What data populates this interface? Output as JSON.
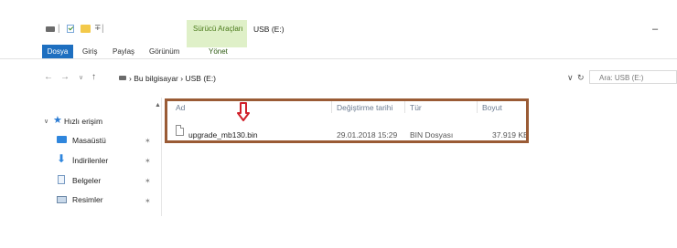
{
  "titlebar": {
    "context_tab_label": "Sürücü Araçları",
    "window_title": "USB (E:)",
    "minimize_glyph": "–",
    "qa_separator": "|",
    "qa_dropdown": "∓"
  },
  "ribbon": {
    "tabs": [
      {
        "label": "Dosya"
      },
      {
        "label": "Giriş"
      },
      {
        "label": "Paylaş"
      },
      {
        "label": "Görünüm"
      },
      {
        "label": "Yönet"
      }
    ]
  },
  "nav": {
    "back": "←",
    "forward": "→",
    "dropdown": "∨",
    "up": "↑",
    "address_sep1": "›",
    "address_pc": "Bu bilgisayar",
    "address_sep2": "›",
    "address_drive": "USB (E:)",
    "address_dropdown": "∨",
    "refresh": "↻",
    "search_placeholder": "Ara: USB (E:)"
  },
  "sidebar": {
    "expand_glyph": "∨",
    "quick_access_label": "Hızlı erişim",
    "items": [
      {
        "label": "Masaüstü",
        "icon": "desktop-icon"
      },
      {
        "label": "İndirilenler",
        "icon": "download-icon"
      },
      {
        "label": "Belgeler",
        "icon": "documents-icon"
      },
      {
        "label": "Resimler",
        "icon": "pictures-icon"
      }
    ],
    "pin_glyph": "✶",
    "scroll_up_glyph": "▲"
  },
  "file_list": {
    "columns": [
      "Ad",
      "Değiştirme tarihi",
      "Tür",
      "Boyut"
    ],
    "rows": [
      {
        "name": "upgrade_mb130.bin",
        "modified": "29.01.2018 15:29",
        "type": "BIN Dosyası",
        "size": "37.919 KB"
      }
    ]
  },
  "colors": {
    "accent": "#1e6fc0",
    "context_tab": "#dff0c8",
    "highlight_border": "#9a5b35",
    "annotation_arrow": "#d0202a"
  }
}
